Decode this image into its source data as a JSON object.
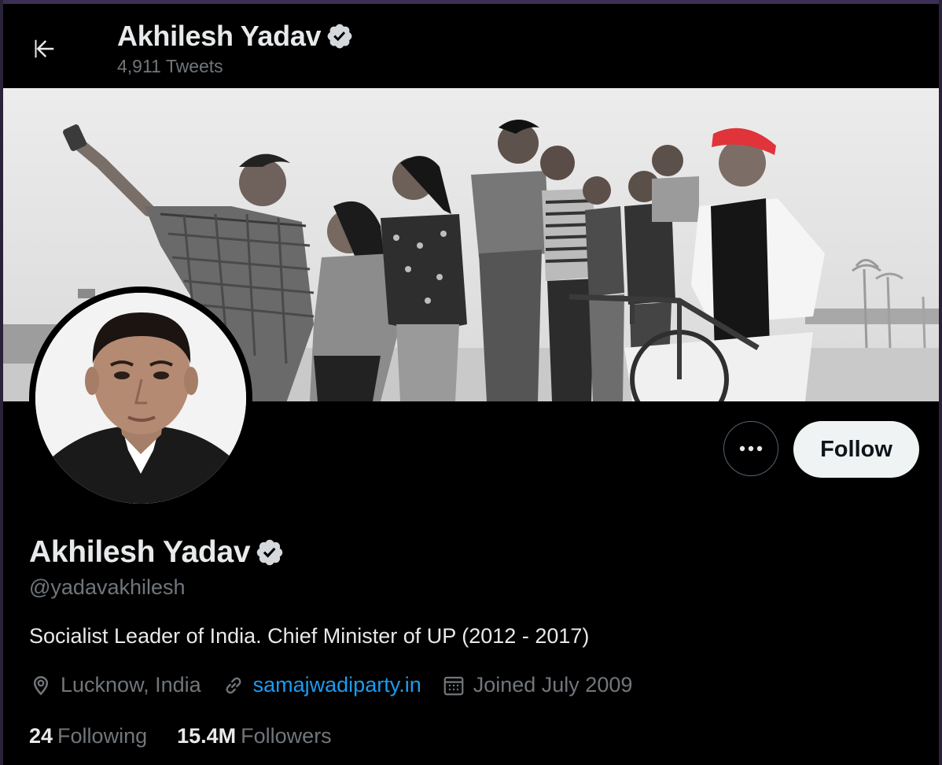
{
  "header": {
    "title": "Akhilesh Yadav",
    "tweet_count": "4,911 Tweets"
  },
  "profile": {
    "name": "Akhilesh Yadav",
    "handle": "@yadavakhilesh",
    "bio": "Socialist Leader of India. Chief Minister of UP (2012 - 2017)",
    "location": "Lucknow, India",
    "website": "samajwadiparty.in",
    "joined": "Joined July 2009",
    "following_count": "24",
    "following_label": "Following",
    "followers_count": "15.4M",
    "followers_label": "Followers",
    "verified": true
  },
  "actions": {
    "more_label": "•••",
    "follow_label": "Follow"
  },
  "colors": {
    "background": "#000000",
    "text_primary": "#e7e9ea",
    "text_secondary": "#71767b",
    "link": "#1d9bf0",
    "follow_button_bg": "#eff3f4",
    "cap_red": "#e0333a"
  },
  "icons": {
    "back": "arrow-left-icon",
    "verified": "verified-badge-icon",
    "more": "more-horizontal-icon",
    "location": "location-pin-icon",
    "link": "link-icon",
    "calendar": "calendar-icon"
  }
}
